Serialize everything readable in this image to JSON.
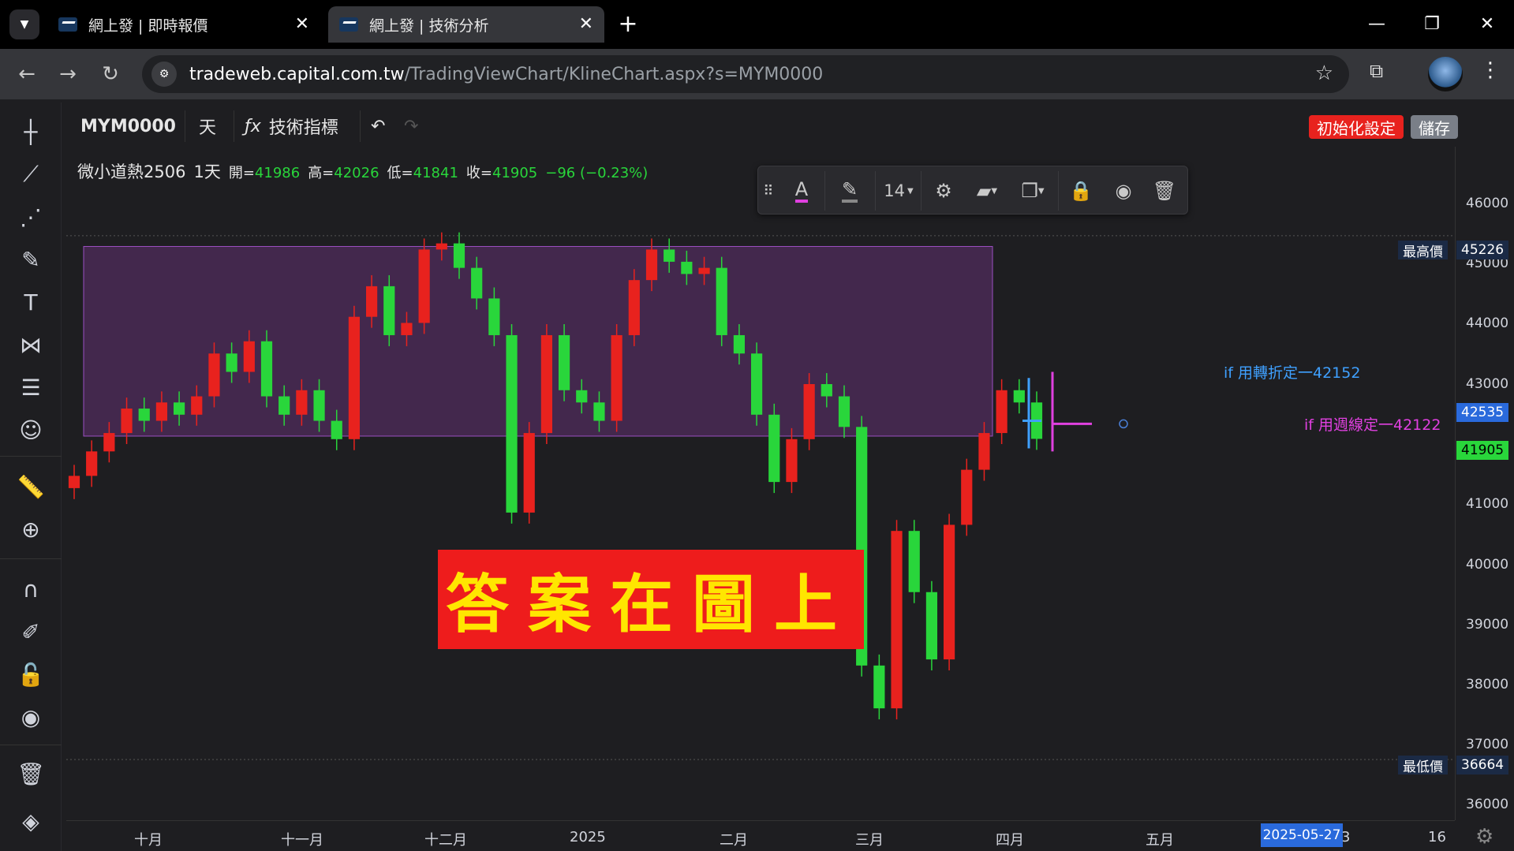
{
  "browser": {
    "tabs": [
      {
        "title": "網上發 | 即時報價",
        "close": "✕"
      },
      {
        "title": "網上發 | 技術分析",
        "close": "✕"
      }
    ],
    "url_host": "tradeweb.capital.com.tw",
    "url_path": "/TradingViewChart/KlineChart.aspx?s=MYM0000"
  },
  "toolbar": {
    "symbol": "MYM0000",
    "interval": "天",
    "indicators_label": "技術指標",
    "reset_label": "初始化設定",
    "save_label": "儲存"
  },
  "legend": {
    "name": "微小道熱2506",
    "interval": "1天",
    "open_label": "開=",
    "open": "41986",
    "high_label": "高=",
    "high": "42026",
    "low_label": "低=",
    "low": "41841",
    "close_label": "收=",
    "close": "41905",
    "change": "−96 (−0.23%)"
  },
  "floating_toolbar": {
    "font_size": "14"
  },
  "price_axis": {
    "labels": [
      "46000",
      "45000",
      "44000",
      "43000",
      "41000",
      "40000",
      "39000",
      "38000",
      "37000",
      "36000"
    ],
    "high_tag": {
      "label": "最高價",
      "value": "45226"
    },
    "low_tag": {
      "label": "最低價",
      "value": "36664"
    },
    "blue_tag": "42535",
    "last_tag": "41905"
  },
  "time_axis": {
    "labels": [
      "十月",
      "十一月",
      "十二月",
      "2025",
      "二月",
      "三月",
      "四月",
      "五月",
      "16"
    ],
    "current_date": "2025-05-27",
    "current_date_suffix": "3"
  },
  "annotations": {
    "answer": "答案在圖上",
    "turning_point": "if 用轉折定一42152",
    "weekly": "if 用週線定一42122"
  },
  "colors": {
    "up": "#e8221e",
    "down": "#29d63b",
    "box_fill": "#4a2a55",
    "box_border": "#9b4fc2",
    "blue_anno": "#3fa0ff",
    "magenta_anno": "#e040e0"
  },
  "chart_data": {
    "type": "candlestick",
    "symbol": "MYM0000",
    "x_labels": [
      "十月",
      "十一月",
      "十二月",
      "2025",
      "二月",
      "三月",
      "四月",
      "五月",
      "16"
    ],
    "ylim": [
      35800,
      46500
    ],
    "high_price": 45226,
    "low_price": 36664,
    "last_close": 41905,
    "range_box": [
      41950,
      45050
    ],
    "closes": [
      41300,
      41700,
      42000,
      42400,
      42200,
      42500,
      42300,
      42600,
      43300,
      43000,
      43500,
      42600,
      42300,
      42700,
      42200,
      41900,
      43900,
      44400,
      43600,
      43800,
      45000,
      45100,
      44700,
      44200,
      43600,
      40700,
      42000,
      43600,
      42700,
      42500,
      42200,
      43600,
      44500,
      45000,
      44800,
      44600,
      44700,
      43600,
      43300,
      42300,
      41200,
      41900,
      42800,
      42600,
      42100,
      38200,
      37500,
      40400,
      39400,
      38300,
      40500,
      41400,
      42000,
      42700,
      42500,
      41905
    ]
  }
}
